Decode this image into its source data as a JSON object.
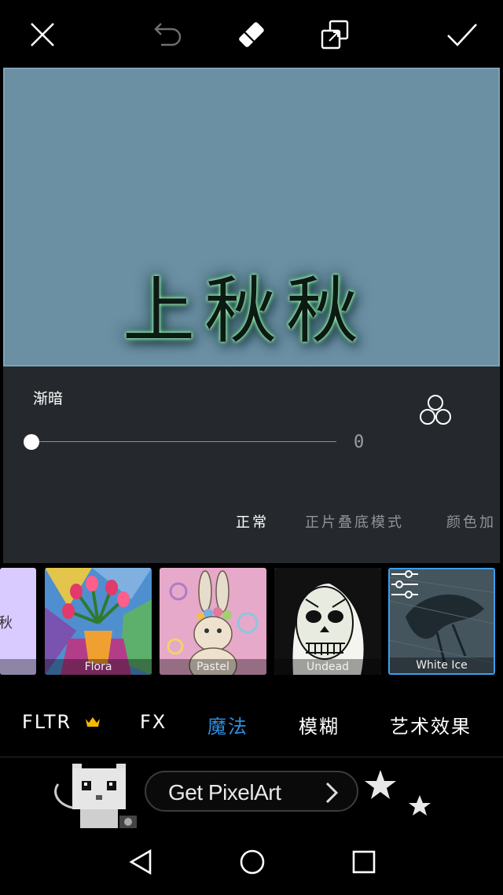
{
  "toolbar": {
    "icons": [
      "close-icon",
      "undo-icon",
      "eraser-icon",
      "layer-swap-icon",
      "checkmark-icon"
    ]
  },
  "canvas": {
    "text": "上秋秋",
    "background": "#6b8fa3"
  },
  "panel": {
    "title": "渐暗",
    "slider_value": "0",
    "slider_fraction": 0,
    "blend_modes": [
      {
        "label": "正常",
        "active": true
      },
      {
        "label": "正片叠底模式",
        "active": false
      },
      {
        "label": "颜色加",
        "active": false
      }
    ]
  },
  "effects": {
    "items": [
      {
        "label": "",
        "partial_text": "秋"
      },
      {
        "label": "Flora"
      },
      {
        "label": "Pastel"
      },
      {
        "label": "Undead"
      },
      {
        "label": "White Ice",
        "selected": true
      }
    ]
  },
  "tabs": {
    "items": [
      {
        "label": "FLTR",
        "premium": true
      },
      {
        "label": "FX"
      },
      {
        "label": "魔法",
        "active": true
      },
      {
        "label": "模糊"
      },
      {
        "label": "艺术效果"
      }
    ]
  },
  "ad": {
    "button_text": "Get PixelArt"
  },
  "colors": {
    "accent": "#2e8fe3",
    "selected_border": "#3aa0ef",
    "crown": "#f5b800"
  }
}
